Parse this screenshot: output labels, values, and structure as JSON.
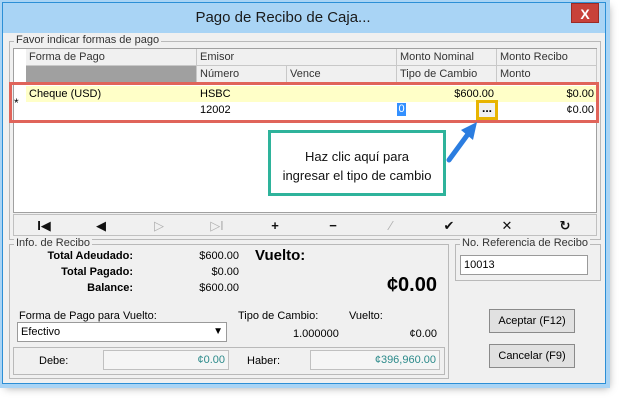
{
  "window": {
    "title": "Pago de Recibo de Caja...",
    "close_label": "X"
  },
  "grid": {
    "group_title": "Favor indicar formas de pago",
    "headers_top": [
      "Forma de Pago",
      "Emisor",
      "Monto Nominal",
      "Monto Recibo"
    ],
    "headers_bottom": [
      "Número",
      "Vence",
      "Tipo de Cambio",
      "Monto"
    ],
    "row_marker": "*",
    "row1": {
      "forma": "Cheque (USD)",
      "emisor": "HSBC",
      "nominal": "$600.00",
      "recibo": "$0.00"
    },
    "row2": {
      "numero": "12002",
      "tipo_cambio": "0",
      "monto": "¢0.00",
      "ellipsis": "..."
    }
  },
  "callout": {
    "line1": "Haz clic aquí para",
    "line2": "ingresar el tipo de cambio"
  },
  "navbar": {
    "first": "I◀",
    "prev": "◀",
    "next": "▷",
    "last": "▷I",
    "add": "+",
    "remove": "−",
    "edit": "⁄",
    "confirm": "✔",
    "cancel": "✕",
    "refresh": "↻"
  },
  "info": {
    "group_title": "Info. de Recibo",
    "total_adeudado_label": "Total Adeudado:",
    "total_adeudado": "$600.00",
    "total_pagado_label": "Total Pagado:",
    "total_pagado": "$0.00",
    "balance_label": "Balance:",
    "balance": "$600.00",
    "vuelto_label": "Vuelto:",
    "vuelto_big": "¢0.00",
    "forma_vuelto_label": "Forma de Pago para Vuelto:",
    "forma_vuelto_value": "Efectivo",
    "tipo_cambio_label": "Tipo de Cambio:",
    "tipo_cambio_value": "1.000000",
    "vuelto_small_label": "Vuelto:",
    "vuelto_small_value": "¢0.00",
    "debe_label": "Debe:",
    "debe_value": "¢0.00",
    "haber_label": "Haber:",
    "haber_value": "¢396,960.00"
  },
  "referencia": {
    "group_title": "No. Referencia de Recibo",
    "value": "10013"
  },
  "buttons": {
    "accept": "Aceptar (F12)",
    "cancel": "Cancelar (F9)"
  },
  "colors": {
    "title_bar": "#a9d4f5",
    "highlight_box": "#e0645a",
    "button_highlight": "#e8b400",
    "callout_border": "#2eb39b",
    "arrow": "#2b7de0"
  }
}
